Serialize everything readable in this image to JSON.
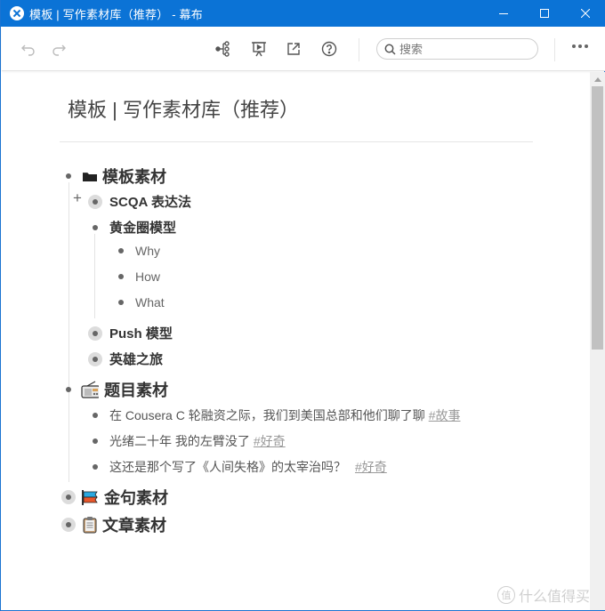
{
  "window": {
    "title": "模板 | 写作素材库（推荐） - 幕布",
    "controls": {
      "minimize": "minimize-icon",
      "maximize": "maximize-icon",
      "close": "close-icon"
    }
  },
  "toolbar": {
    "undo": "undo-icon",
    "redo": "redo-icon",
    "mindmap": "mindmap-icon",
    "present": "presentation-icon",
    "export": "export-icon",
    "help": "help-icon",
    "search_placeholder": "搜索",
    "more": "more-icon"
  },
  "document": {
    "title": "模板 | 写作素材库（推荐）",
    "outline": [
      {
        "text": "模板素材",
        "emoji": "folder",
        "collapsed": false,
        "children": [
          {
            "text": "SCQA 表达法",
            "collapsed": true
          },
          {
            "text": "黄金圈模型",
            "collapsed": false,
            "children": [
              {
                "text": "Why"
              },
              {
                "text": "How"
              },
              {
                "text": "What"
              }
            ]
          },
          {
            "text": "Push 模型",
            "collapsed": true
          },
          {
            "text": "英雄之旅",
            "collapsed": true
          }
        ]
      },
      {
        "text": "题目素材",
        "emoji": "radio",
        "collapsed": false,
        "children": [
          {
            "text": "在 Cousera C 轮融资之际，我们到美国总部和他们聊了聊",
            "tag": "#故事"
          },
          {
            "text": "光绪二十年 我的左臂没了",
            "tag": "#好奇"
          },
          {
            "text": "这还是那个写了《人间失格》的太宰治吗？",
            "tag": "#好奇"
          }
        ]
      },
      {
        "text": "金句素材",
        "emoji": "carp-streamer",
        "collapsed": true
      },
      {
        "text": "文章素材",
        "emoji": "clipboard",
        "collapsed": true
      }
    ]
  },
  "watermark": {
    "badge": "值",
    "text": "什么值得买"
  },
  "colors": {
    "titlebar": "#0b73d6",
    "scroll_thumb": "#c1c1c1",
    "tag": "#999999"
  }
}
